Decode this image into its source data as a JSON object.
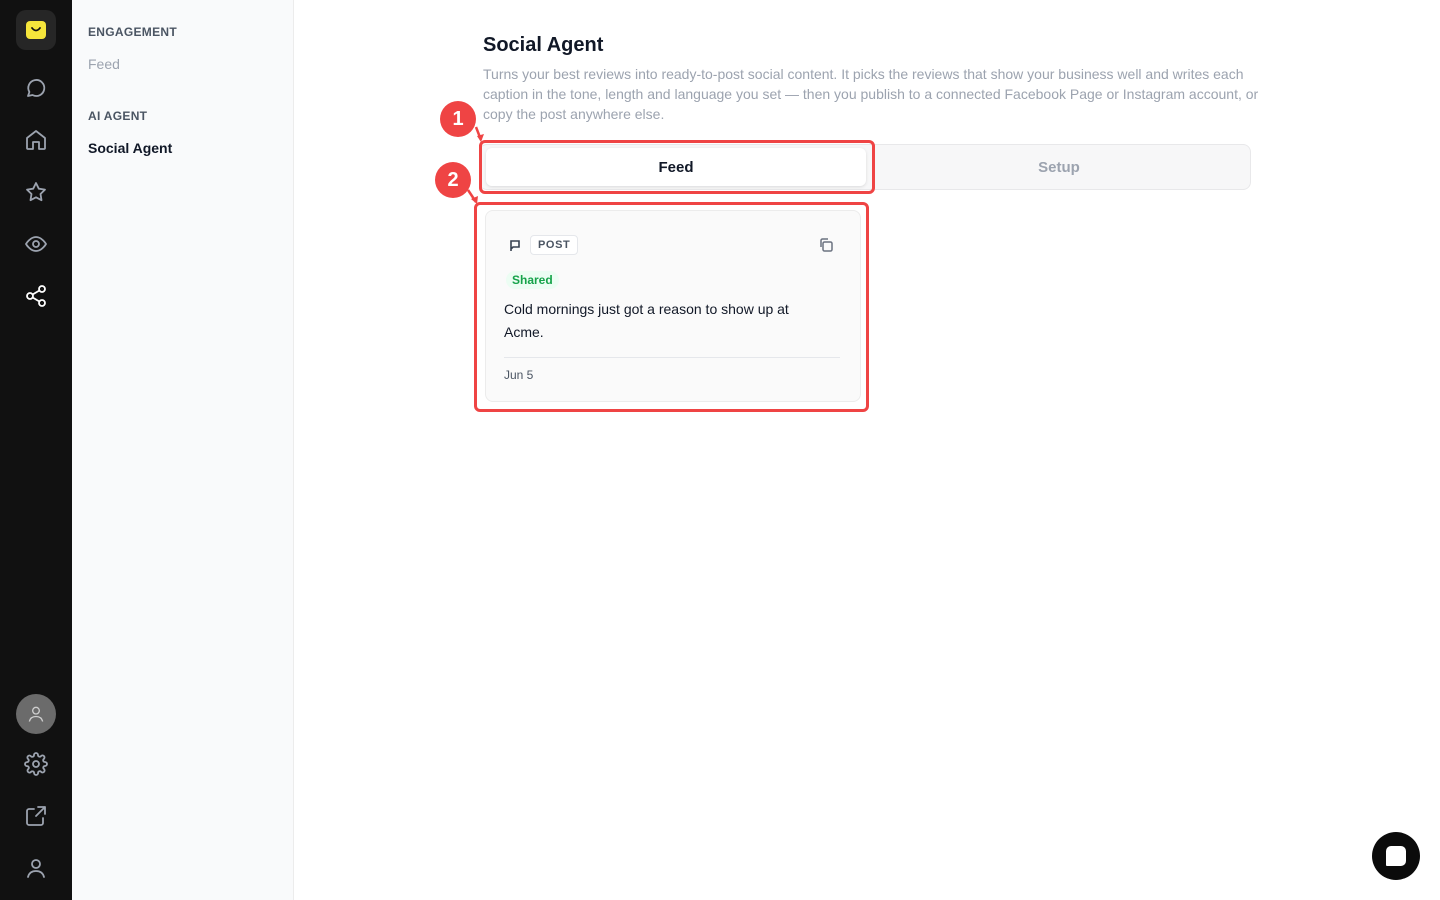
{
  "rail": {
    "icons": [
      "logo-chat-icon",
      "chat-bubble-icon",
      "home-icon",
      "star-icon",
      "eye-icon",
      "share-icon",
      "avatar-icon",
      "gear-icon",
      "external-link-icon",
      "user-icon"
    ],
    "active": "share-icon",
    "logo_color": "#f5e53b"
  },
  "subnav": {
    "engagement_heading": "ENGAGEMENT",
    "feed_label": "Feed",
    "ai_agent_heading": "AI AGENT",
    "social_agent_label": "Social Agent"
  },
  "main": {
    "title": "Social Agent",
    "description": "Turns your best reviews into ready-to-post social content. It picks the reviews that show your business well and writes each caption in the tone, length and language you set — then you publish to a connected Facebook Page or Instagram account, or copy the post anywhere else.",
    "tabs": [
      {
        "label": "Feed",
        "active": true
      },
      {
        "label": "Setup",
        "active": false
      }
    ],
    "card": {
      "type_label": "POST",
      "status": "Shared",
      "status_color": "#16a34a",
      "text": "Cold mornings just got a reason to show up at Acme.",
      "date": "Jun 5"
    }
  },
  "annotations": {
    "marker_1": "1",
    "marker_2": "2",
    "color": "#ef4444"
  }
}
